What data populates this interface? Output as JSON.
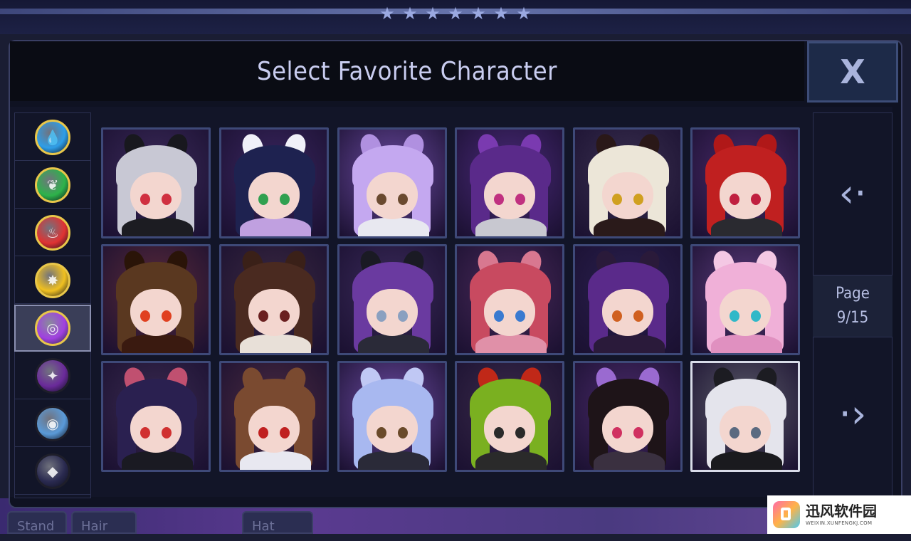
{
  "header": {
    "title": "Select Favorite Character",
    "close_label": "X"
  },
  "decor": {
    "stars": [
      "★",
      "★",
      "★",
      "★",
      "★",
      "★",
      "★"
    ]
  },
  "background_tabs": [
    "Stand",
    "Hair",
    "Hat"
  ],
  "elements": [
    {
      "name": "water",
      "color": "#2e9ee8",
      "glyph": "💧",
      "active": false
    },
    {
      "name": "nature",
      "color": "#2db34a",
      "glyph": "❦",
      "active": false
    },
    {
      "name": "fire",
      "color": "#e03232",
      "glyph": "♨",
      "active": false
    },
    {
      "name": "light",
      "color": "#f0c020",
      "glyph": "✸",
      "active": false
    },
    {
      "name": "dark",
      "color": "#a040e0",
      "glyph": "◎",
      "active": true
    },
    {
      "name": "shadow",
      "color": "#6a2a9a",
      "glyph": "✦",
      "active": false
    },
    {
      "name": "spirit",
      "color": "#5a9ad8",
      "glyph": "◉",
      "active": false
    },
    {
      "name": "void",
      "color": "#2a2a50",
      "glyph": "◆",
      "active": false
    }
  ],
  "characters": [
    {
      "bg": "#3b2a5a",
      "hair": "#c8c8d4",
      "eye": "#d03040",
      "outfit": "#1c1c22",
      "ears": "#18181e",
      "selected": false
    },
    {
      "bg": "#3a2660",
      "hair": "#1e2250",
      "eye": "#30a050",
      "outfit": "#c0a0e0",
      "ears": "#f0f0f8",
      "selected": false
    },
    {
      "bg": "#6a4aa0",
      "hair": "#c4a8f0",
      "eye": "#6a4a30",
      "outfit": "#e8e8f0",
      "ears": "#b090e0",
      "selected": false
    },
    {
      "bg": "#4a2a7a",
      "hair": "#5a2a8a",
      "eye": "#c03080",
      "outfit": "#c8c8d0",
      "ears": "#7a3ab0",
      "selected": false
    },
    {
      "bg": "#3a3050",
      "hair": "#ece6d8",
      "eye": "#d0a020",
      "outfit": "#2a1a1a",
      "ears": "#2a1818",
      "selected": false
    },
    {
      "bg": "#4a2a6a",
      "hair": "#c02020",
      "eye": "#c02040",
      "outfit": "#2a2a30",
      "ears": "#b01818",
      "selected": false
    },
    {
      "bg": "#5a2a3a",
      "hair": "#5a3820",
      "eye": "#e04020",
      "outfit": "#3a1a10",
      "ears": "#2a1408",
      "selected": false
    },
    {
      "bg": "#3a2840",
      "hair": "#4a2a20",
      "eye": "#6a2020",
      "outfit": "#e8e0d8",
      "ears": "#3a2018",
      "selected": false
    },
    {
      "bg": "#3a2a5a",
      "hair": "#6a3aa0",
      "eye": "#8aa0c0",
      "outfit": "#2a2a38",
      "ears": "#1a1a24",
      "selected": false
    },
    {
      "bg": "#4a2a5a",
      "hair": "#c84a60",
      "eye": "#3a7ad0",
      "outfit": "#e090a8",
      "ears": "#d87890",
      "selected": false
    },
    {
      "bg": "#2a2050",
      "hair": "#5a2a8a",
      "eye": "#d06020",
      "outfit": "#2a1a3a",
      "ears": "#2a1a3a",
      "selected": false
    },
    {
      "bg": "#5a3a7a",
      "hair": "#f0b0d8",
      "eye": "#30b8c8",
      "outfit": "#e090c0",
      "ears": "#f4c8e4",
      "selected": false
    },
    {
      "bg": "#3a2a50",
      "hair": "#2a2050",
      "eye": "#d03030",
      "outfit": "#1a1a22",
      "ears": "#c05070",
      "selected": false
    },
    {
      "bg": "#4a2a40",
      "hair": "#7a4a30",
      "eye": "#c02020",
      "outfit": "#e8e8f0",
      "ears": "#7a4a30",
      "selected": false
    },
    {
      "bg": "#6a4aa0",
      "hair": "#a8b8f0",
      "eye": "#6a4a2a",
      "outfit": "#2a2a38",
      "ears": "#c0c8f4",
      "selected": false
    },
    {
      "bg": "#3a2a4a",
      "hair": "#7ab020",
      "eye": "#2a2a2a",
      "outfit": "#2a2a2a",
      "ears": "#c02818",
      "selected": false
    },
    {
      "bg": "#4a2a6a",
      "hair": "#1e1418",
      "eye": "#d03060",
      "outfit": "#3a3040",
      "ears": "#9a6ad0",
      "selected": false
    },
    {
      "bg": "#5a5a68",
      "hair": "#e4e4ec",
      "eye": "#5a6a80",
      "outfit": "#1a1a1e",
      "ears": "#1c1c22",
      "selected": true
    }
  ],
  "pagination": {
    "label": "Page",
    "value": "9/15",
    "prev_glyph": "‹·",
    "next_glyph": "·›"
  },
  "watermark": {
    "name": "迅风软件园",
    "url": "WEIXIN.XUNFENGKJ.COM"
  }
}
